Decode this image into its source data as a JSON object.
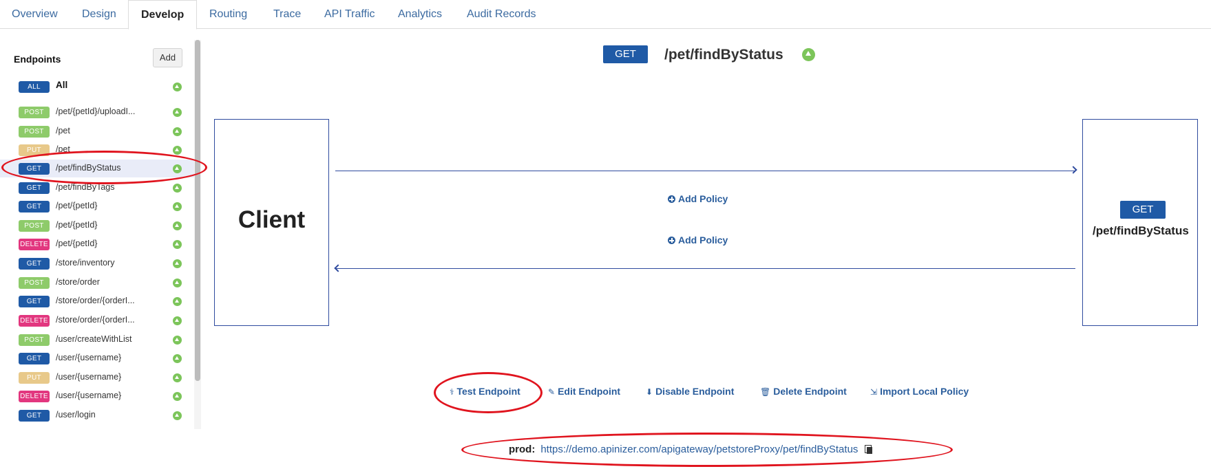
{
  "tabs": [
    {
      "label": "Overview",
      "active": false
    },
    {
      "label": "Design",
      "active": false
    },
    {
      "label": "Develop",
      "active": true
    },
    {
      "label": "Routing",
      "active": false
    },
    {
      "label": "Trace",
      "active": false
    },
    {
      "label": "API Traffic",
      "active": false
    },
    {
      "label": "Analytics",
      "active": false
    },
    {
      "label": "Audit Records",
      "active": false
    }
  ],
  "sidebar": {
    "title": "Endpoints",
    "add_label": "Add",
    "endpoints": [
      {
        "method": "ALL",
        "path": "All",
        "selected": false
      },
      {
        "method": "POST",
        "path": "/pet/{petId}/uploadI...",
        "selected": false
      },
      {
        "method": "POST",
        "path": "/pet",
        "selected": false
      },
      {
        "method": "PUT",
        "path": "/pet",
        "selected": false
      },
      {
        "method": "GET",
        "path": "/pet/findByStatus",
        "selected": true
      },
      {
        "method": "GET",
        "path": "/pet/findByTags",
        "selected": false
      },
      {
        "method": "GET",
        "path": "/pet/{petId}",
        "selected": false
      },
      {
        "method": "POST",
        "path": "/pet/{petId}",
        "selected": false
      },
      {
        "method": "DELETE",
        "path": "/pet/{petId}",
        "selected": false
      },
      {
        "method": "GET",
        "path": "/store/inventory",
        "selected": false
      },
      {
        "method": "POST",
        "path": "/store/order",
        "selected": false
      },
      {
        "method": "GET",
        "path": "/store/order/{orderI...",
        "selected": false
      },
      {
        "method": "DELETE",
        "path": "/store/order/{orderI...",
        "selected": false
      },
      {
        "method": "POST",
        "path": "/user/createWithList",
        "selected": false
      },
      {
        "method": "GET",
        "path": "/user/{username}",
        "selected": false
      },
      {
        "method": "PUT",
        "path": "/user/{username}",
        "selected": false
      },
      {
        "method": "DELETE",
        "path": "/user/{username}",
        "selected": false
      },
      {
        "method": "GET",
        "path": "/user/login",
        "selected": false
      }
    ]
  },
  "method_colors": {
    "ALL": "#1f5aa6",
    "GET": "#1f5aa6",
    "POST": "#8ecb6a",
    "PUT": "#e8c98a",
    "DELETE": "#e2377f"
  },
  "status_color": "#7cc55a",
  "header": {
    "method": "GET",
    "path": "/pet/findByStatus"
  },
  "flow": {
    "client_label": "Client",
    "backend_method": "GET",
    "backend_path": "/pet/findByStatus",
    "request_policy_label": "Add Policy",
    "response_policy_label": "Add Policy"
  },
  "actions": {
    "test": "Test Endpoint",
    "edit": "Edit Endpoint",
    "disable": "Disable Endpoint",
    "delete": "Delete Endpoint",
    "import": "Import Local Policy"
  },
  "prod": {
    "label": "prod:",
    "url": "https://demo.apinizer.com/apigateway/petstoreProxy/pet/findByStatus"
  }
}
